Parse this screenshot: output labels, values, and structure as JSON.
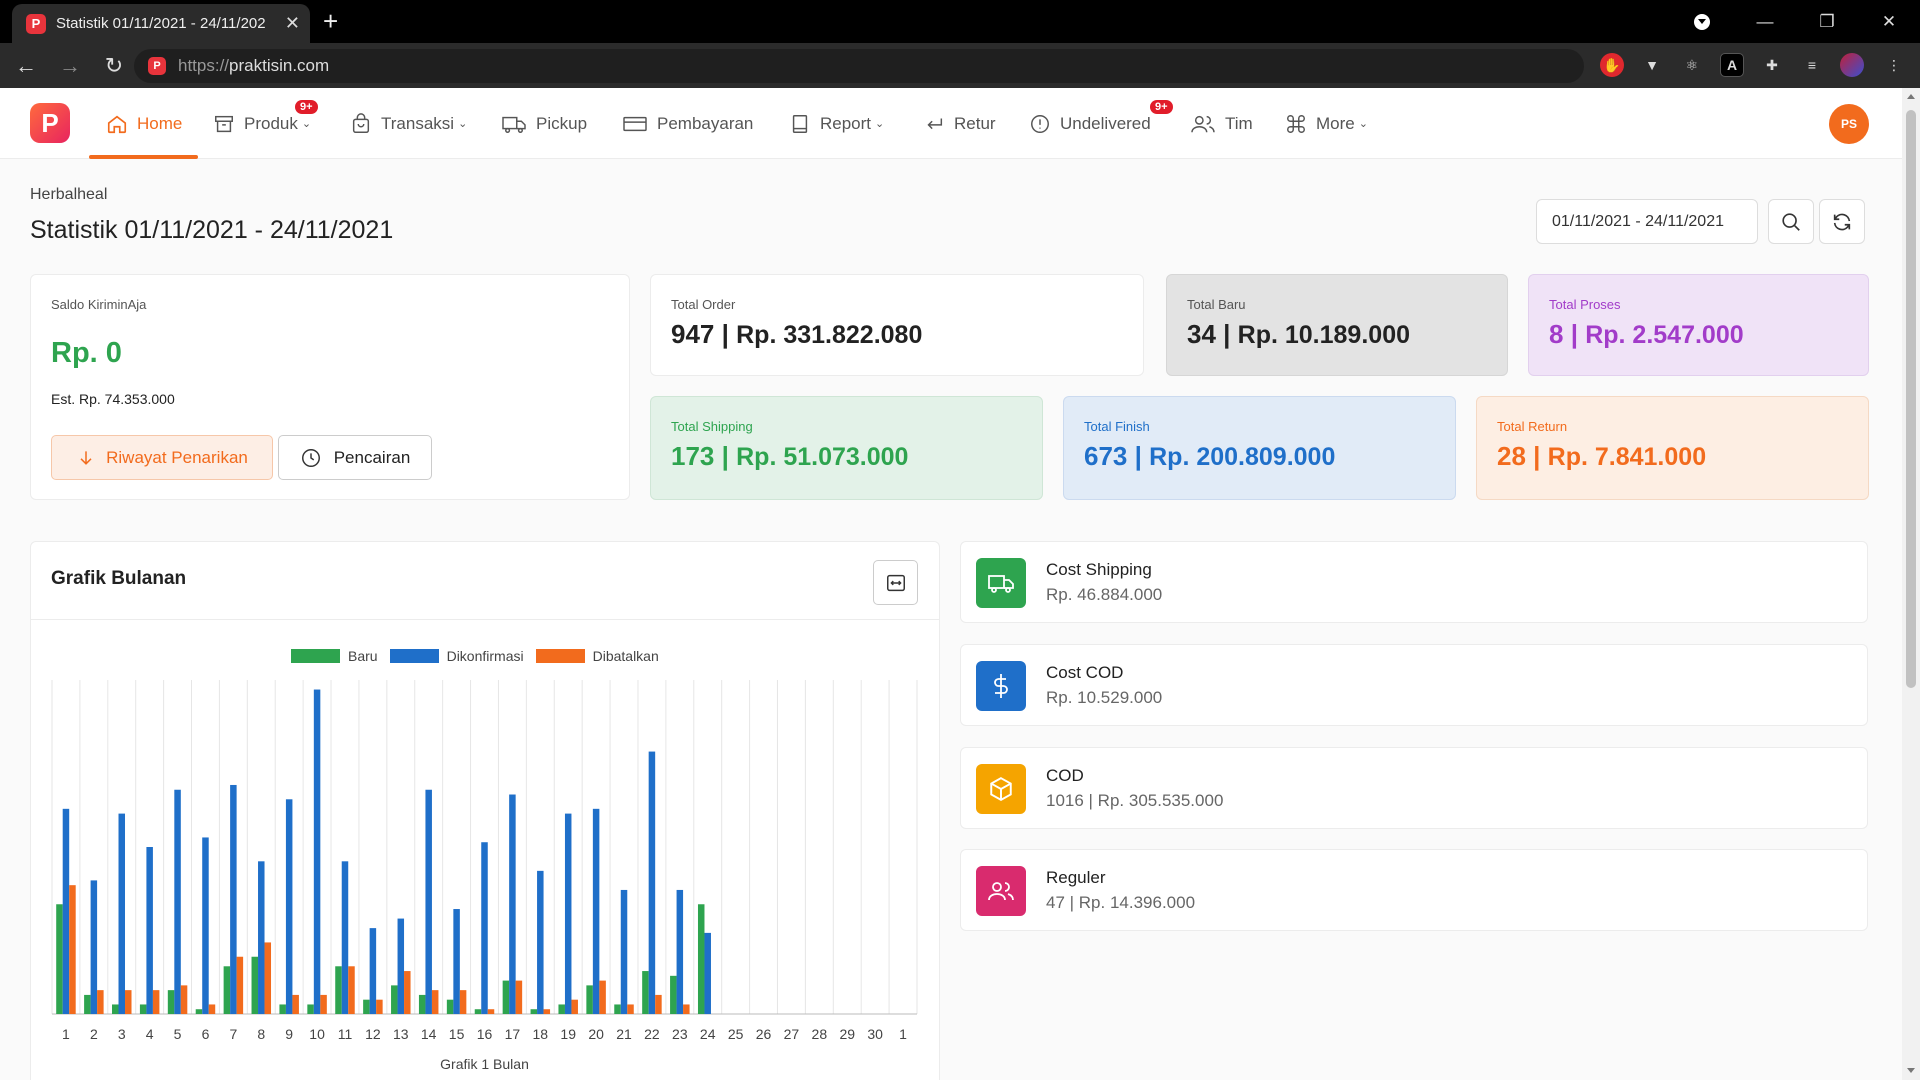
{
  "browser": {
    "tab_title": "Statistik 01/11/2021 - 24/11/202",
    "favicon_letter": "P",
    "url_scheme": "https://",
    "url_host": "praktisin.com"
  },
  "nav": {
    "brand_letter": "P",
    "items": [
      {
        "label": "Home",
        "icon": "home-icon",
        "active": true
      },
      {
        "label": "Produk",
        "icon": "box-icon",
        "has_chevron": true,
        "badge": "9+"
      },
      {
        "label": "Transaksi",
        "icon": "bag-icon",
        "has_chevron": true
      },
      {
        "label": "Pickup",
        "icon": "truck-icon"
      },
      {
        "label": "Pembayaran",
        "icon": "card-icon"
      },
      {
        "label": "Report",
        "icon": "document-icon",
        "has_chevron": true
      },
      {
        "label": "Retur",
        "icon": "return-icon"
      },
      {
        "label": "Undelivered",
        "icon": "alert-icon",
        "badge": "9+"
      },
      {
        "label": "Tim",
        "icon": "users-icon"
      },
      {
        "label": "More",
        "icon": "command-icon",
        "has_chevron": true
      }
    ],
    "avatar": "PS"
  },
  "header": {
    "store": "Herbalheal",
    "title": "Statistik 01/11/2021 - 24/11/2021",
    "date_range": "01/11/2021 - 24/11/2021"
  },
  "saldo": {
    "label": "Saldo KiriminAja",
    "value": "Rp. 0",
    "est": "Est. Rp. 74.353.000",
    "btn_history": "Riwayat Penarikan",
    "btn_withdraw": "Pencairan"
  },
  "stats": {
    "total_order": {
      "label": "Total Order",
      "count": "947",
      "amount": "Rp. 331.822.080"
    },
    "total_baru": {
      "label": "Total Baru",
      "count": "34",
      "amount": "Rp. 10.189.000"
    },
    "total_proses": {
      "label": "Total Proses",
      "count": "8",
      "amount": "Rp. 2.547.000"
    },
    "total_shipping": {
      "label": "Total Shipping",
      "count": "173",
      "amount": "Rp. 51.073.000"
    },
    "total_finish": {
      "label": "Total Finish",
      "count": "673",
      "amount": "Rp. 200.809.000"
    },
    "total_return": {
      "label": "Total Return",
      "count": "28",
      "amount": "Rp. 7.841.000"
    }
  },
  "chart_panel": {
    "title": "Grafik Bulanan"
  },
  "chart_data": {
    "type": "bar",
    "xlabel": "Grafik 1 Bulan",
    "categories": [
      "1",
      "2",
      "3",
      "4",
      "5",
      "6",
      "7",
      "8",
      "9",
      "10",
      "11",
      "12",
      "13",
      "14",
      "15",
      "16",
      "17",
      "18",
      "19",
      "20",
      "21",
      "22",
      "23",
      "24",
      "25",
      "26",
      "27",
      "28",
      "29",
      "30",
      "1"
    ],
    "ylim": [
      0,
      70
    ],
    "colors": [
      "#2ea44f",
      "#1f6fc9",
      "#f26b1d"
    ],
    "series": [
      {
        "name": "Baru",
        "values": [
          23,
          4,
          2,
          2,
          5,
          1,
          10,
          12,
          2,
          2,
          10,
          3,
          6,
          4,
          3,
          1,
          7,
          1,
          2,
          6,
          2,
          9,
          8,
          23,
          0,
          0,
          0,
          0,
          0,
          0,
          0
        ]
      },
      {
        "name": "Dikonfirmasi",
        "values": [
          43,
          28,
          42,
          35,
          47,
          37,
          48,
          32,
          45,
          68,
          32,
          18,
          20,
          47,
          22,
          36,
          46,
          30,
          42,
          43,
          26,
          55,
          26,
          17,
          0,
          0,
          0,
          0,
          0,
          0,
          0
        ]
      },
      {
        "name": "Dibatalkan",
        "values": [
          27,
          5,
          5,
          5,
          6,
          2,
          12,
          15,
          4,
          4,
          10,
          3,
          9,
          5,
          5,
          1,
          7,
          1,
          3,
          7,
          2,
          4,
          2,
          0,
          0,
          0,
          0,
          0,
          0,
          0,
          0
        ]
      }
    ]
  },
  "info_cards": [
    {
      "title": "Cost Shipping",
      "sub": "Rp. 46.884.000",
      "icon": "truck-icon",
      "color": "#2ea44f"
    },
    {
      "title": "Cost COD",
      "sub": "Rp. 10.529.000",
      "icon": "dollar-icon",
      "color": "#1f6fc9"
    },
    {
      "title": "COD",
      "sub": "1016 | Rp. 305.535.000",
      "icon": "package-icon",
      "color": "#f5a400"
    },
    {
      "title": "Reguler",
      "sub": "47 | Rp. 14.396.000",
      "icon": "users-icon",
      "color": "#d92b6e"
    }
  ]
}
